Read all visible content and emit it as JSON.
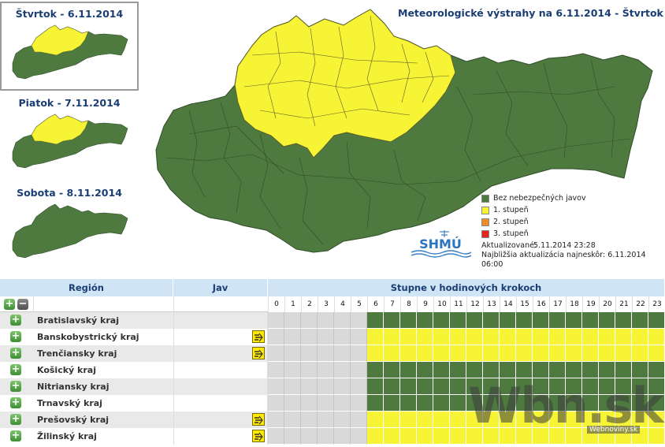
{
  "days": [
    {
      "label": "Štvrtok - 6.11.2014",
      "selected": true,
      "warning": true
    },
    {
      "label": "Piatok - 7.11.2014",
      "selected": false,
      "warning": true
    },
    {
      "label": "Sobota - 8.11.2014",
      "selected": false,
      "warning": false
    }
  ],
  "map_title": "Meteorologické výstrahy na 6.11.2014 - Štvrtok",
  "legend": [
    {
      "label": "Bez nebezpečných javov",
      "color": "#4e7a40"
    },
    {
      "label": "1. stupeň",
      "color": "#f6f435"
    },
    {
      "label": "2. stupeň",
      "color": "#ef8a2a"
    },
    {
      "label": "3. stupeň",
      "color": "#e52420"
    }
  ],
  "logo_text": "SHMÚ",
  "update": {
    "updated_label": "Aktualizované:",
    "updated_value": "5.11.2014 23:28",
    "next_label": "Najbližšia aktualizácia najneskôr:",
    "next_value": "6.11.2014 06:00"
  },
  "table": {
    "col_region": "Región",
    "col_jav": "Jav",
    "col_hours": "Stupne v hodinových krokoch",
    "hours": [
      "0",
      "1",
      "2",
      "3",
      "4",
      "5",
      "6",
      "7",
      "8",
      "9",
      "10",
      "11",
      "12",
      "13",
      "14",
      "15",
      "16",
      "17",
      "18",
      "19",
      "20",
      "21",
      "22",
      "23"
    ],
    "first_active_hour": 6,
    "rows": [
      {
        "region": "Bratislavský kraj",
        "level": 0,
        "icon": ""
      },
      {
        "region": "Banskobystrický kraj",
        "level": 1,
        "icon": "wind-warning-icon"
      },
      {
        "region": "Trenčiansky kraj",
        "level": 1,
        "icon": "wind-warning-icon"
      },
      {
        "region": "Košický kraj",
        "level": 0,
        "icon": ""
      },
      {
        "region": "Nitriansky kraj",
        "level": 0,
        "icon": ""
      },
      {
        "region": "Trnavský kraj",
        "level": 0,
        "icon": ""
      },
      {
        "region": "Prešovský kraj",
        "level": 1,
        "icon": "wind-warning-icon"
      },
      {
        "region": "Žilinský kraj",
        "level": 1,
        "icon": "wind-warning-icon"
      }
    ]
  },
  "watermark": "Wbn.sk",
  "watermark_sub": "Webnoviny.sk",
  "colors": {
    "green": "#4e7a40",
    "yellow": "#f6f435",
    "inactive": "#d9d9d9",
    "header": "#cfe4f4"
  }
}
